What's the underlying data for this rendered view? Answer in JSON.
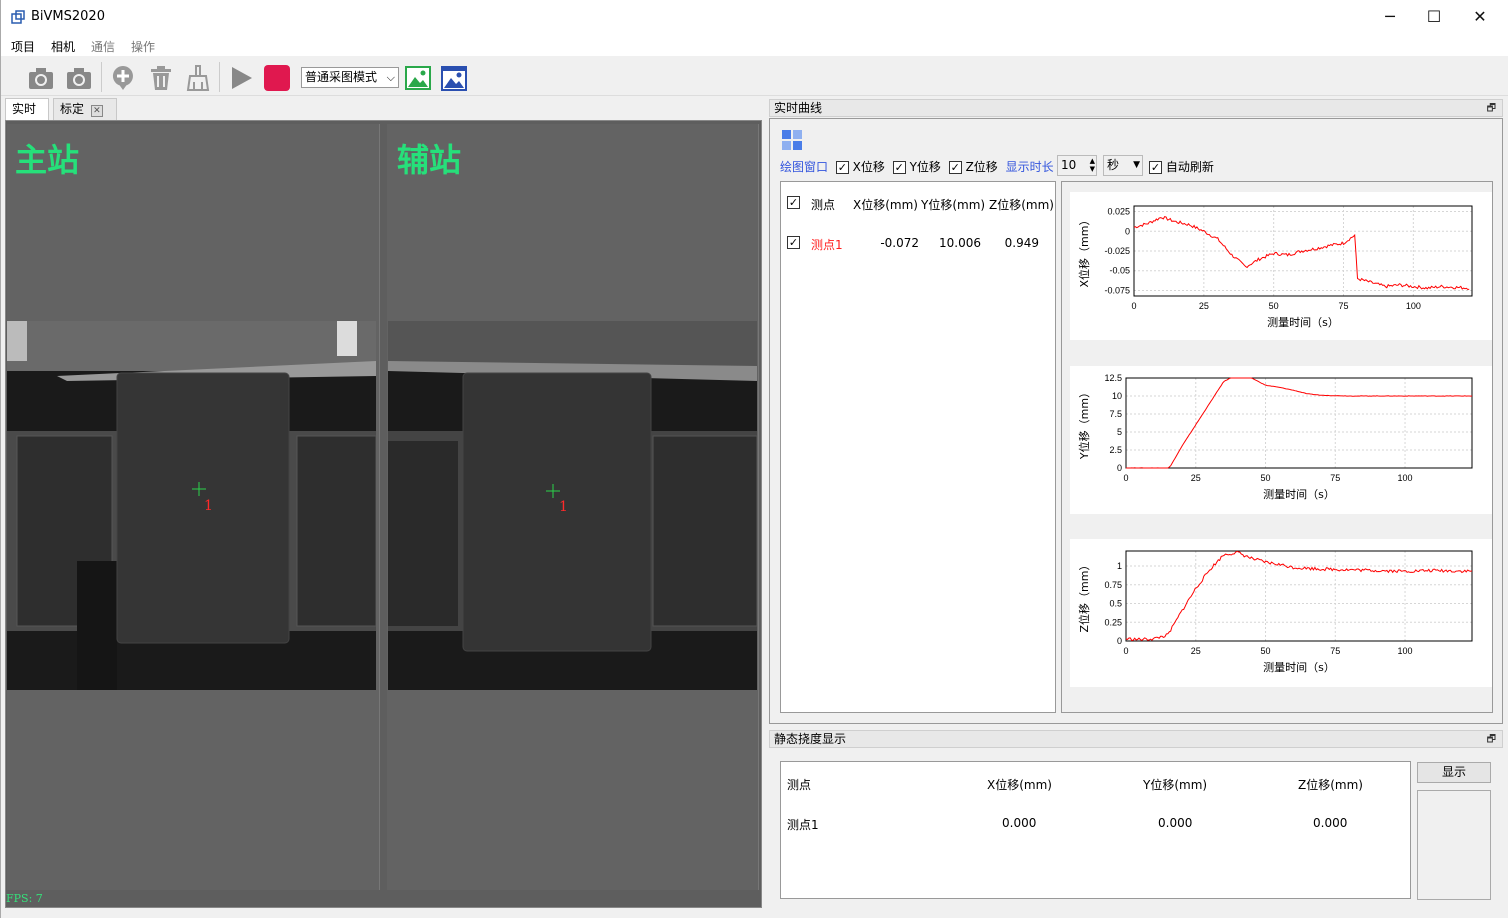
{
  "window": {
    "title": "BiVMS2020",
    "minimize": "─",
    "maximize": "☐",
    "close": "✕"
  },
  "menu": [
    "项目",
    "相机",
    "通信",
    "操作"
  ],
  "toolbar": {
    "icons": [
      "camera-icon",
      "camera-icon",
      "add-circle-icon",
      "trash-icon",
      "broom-icon",
      "play-icon",
      "stop-icon",
      "image-green-icon",
      "image-blue-icon"
    ],
    "mode_value": "普通采图模式",
    "mode_arrow": "⌵"
  },
  "tabs": [
    {
      "label": "实时"
    },
    {
      "label": "标定",
      "close": "✕"
    }
  ],
  "live": {
    "primary_label": "主站",
    "secondary_label": "辅站",
    "marker_number": "1",
    "fps": "FPS: 7"
  },
  "curve": {
    "title": "实时曲线",
    "float_icon": "🗗",
    "plot_window_label": "绘图窗口",
    "x_check": "X位移",
    "y_check": "Y位移",
    "z_check": "Z位移",
    "duration_label": "显示时长",
    "duration_value": "10",
    "unit_value": "秒",
    "auto_refresh": "自动刷新",
    "table_headers": [
      "测点",
      "X位移(mm)",
      "Y位移(mm)",
      "Z位移(mm)"
    ],
    "rows": [
      {
        "name": "测点1",
        "x": "-0.072",
        "y": "10.006",
        "z": "0.949"
      }
    ]
  },
  "chart_data": [
    {
      "type": "line",
      "xlabel": "测量时间（s）",
      "ylabel": "X位移（mm）",
      "xlim": [
        0,
        121
      ],
      "ylim": [
        -0.082,
        0.032
      ],
      "xticks": [
        "0",
        "25",
        "50",
        "75",
        "100"
      ],
      "yticks": [
        "0.025",
        "0",
        "-0.025",
        "-0.05",
        "-0.075"
      ],
      "xtick_values": [
        0,
        25,
        50,
        75,
        100
      ],
      "ytick_values": [
        0.025,
        0,
        -0.025,
        -0.05,
        -0.075
      ],
      "grid": true,
      "color": "#ff0000",
      "x": [
        0,
        5,
        10,
        15,
        20,
        25,
        30,
        35,
        40,
        45,
        50,
        55,
        60,
        65,
        70,
        75,
        79,
        80,
        85,
        90,
        95,
        100,
        105,
        110,
        115,
        120
      ],
      "y": [
        0.005,
        0.01,
        0.018,
        0.012,
        0.008,
        0.0,
        -0.01,
        -0.03,
        -0.045,
        -0.035,
        -0.028,
        -0.03,
        -0.025,
        -0.022,
        -0.018,
        -0.015,
        -0.005,
        -0.06,
        -0.065,
        -0.07,
        -0.068,
        -0.07,
        -0.072,
        -0.07,
        -0.071,
        -0.072
      ]
    },
    {
      "type": "line",
      "xlabel": "测量时间（s）",
      "ylabel": "Y位移（mm）",
      "xlim": [
        0,
        124
      ],
      "ylim": [
        0,
        12.5
      ],
      "xticks": [
        "0",
        "25",
        "50",
        "75",
        "100"
      ],
      "yticks": [
        "12.5",
        "10",
        "7.5",
        "5",
        "2.5",
        "0"
      ],
      "xtick_values": [
        0,
        25,
        50,
        75,
        100
      ],
      "ytick_values": [
        12.5,
        10,
        7.5,
        5,
        2.5,
        0
      ],
      "grid": true,
      "color": "#ff0000",
      "x": [
        0,
        15,
        16,
        20,
        25,
        30,
        35,
        40,
        45,
        50,
        55,
        60,
        65,
        70,
        80,
        90,
        100,
        110,
        124
      ],
      "y": [
        0,
        0,
        0.3,
        3,
        6,
        9,
        12,
        13,
        12.5,
        11.5,
        11.2,
        10.8,
        10.3,
        10.1,
        10.0,
        10.0,
        10.0,
        10.0,
        10.0
      ]
    },
    {
      "type": "line",
      "xlabel": "测量时间（s）",
      "ylabel": "Z位移（mm）",
      "xlim": [
        0,
        124
      ],
      "ylim": [
        0,
        1.2
      ],
      "xticks": [
        "0",
        "25",
        "50",
        "75",
        "100"
      ],
      "yticks": [
        "1",
        "0.75",
        "0.5",
        "0.25",
        "0"
      ],
      "xtick_values": [
        0,
        25,
        50,
        75,
        100
      ],
      "ytick_values": [
        1,
        0.75,
        0.5,
        0.25,
        0
      ],
      "grid": true,
      "color": "#ff0000",
      "x": [
        0,
        5,
        10,
        15,
        20,
        25,
        30,
        35,
        40,
        45,
        50,
        55,
        60,
        65,
        70,
        80,
        90,
        100,
        110,
        124
      ],
      "y": [
        0.03,
        0.02,
        0.03,
        0.08,
        0.4,
        0.7,
        0.95,
        1.15,
        1.18,
        1.1,
        1.05,
        1.02,
        0.98,
        0.97,
        0.96,
        0.95,
        0.94,
        0.93,
        0.94,
        0.93
      ]
    }
  ],
  "static": {
    "title": "静态挠度显示",
    "float_icon": "🗗",
    "headers": [
      "测点",
      "X位移(mm)",
      "Y位移(mm)",
      "Z位移(mm)"
    ],
    "rows": [
      {
        "name": "测点1",
        "x": "0.000",
        "y": "0.000",
        "z": "0.000"
      }
    ],
    "show_button": "显示"
  }
}
